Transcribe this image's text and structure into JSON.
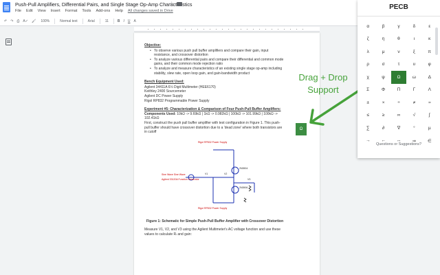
{
  "doc": {
    "title": "Push-Pull Amplifiers, Differential Pairs, and Single Stage Op-Amp Characteristics",
    "menu": [
      "File",
      "Edit",
      "View",
      "Insert",
      "Format",
      "Tools",
      "Add-ons",
      "Help"
    ],
    "saved_status": "All changes saved in Drive"
  },
  "toolbar": {
    "zoom": "100%",
    "style": "Normal text",
    "font": "Arial",
    "size": "11"
  },
  "content": {
    "objective_title": "Objective:",
    "objectives": [
      "To observe various push pull buffer amplifiers and compare their gain, input resistance, and crossover distortion",
      "To analyze various differential pairs and compare their differential and common mode gains, and their common mode rejection ratio",
      "To analyze and measure characteristics of an existing single stage op-amp including stability, slew rate, open loop gain, and gain-bandwidth product"
    ],
    "bench_title": "Bench Equipment Used:",
    "bench_items": [
      "Agilent 34411A 6½ Digit Multimeter (HEE6170)",
      "Keithley 2400 Sourcemeter",
      "Agilent DC Power Supply",
      "Rigol RP832 Programmable Power Supply"
    ],
    "experiment_title": "Experiment #5: Characterization & Comparison of Four Push-Pull Buffer Amplifiers:",
    "components_label": "Components Used:",
    "components_text": "10kΩ -> 9.69kΩ | 1kΩ -> 0.982kΩ | 100kΩ -> 101.99kΩ | 100kΩ -> 102.41kΩ",
    "first_paragraph": "First, construct the push pull buffer amplifier with test configuration in Figure 1. This push-pull buffer should have crossover distortion due to a 'dead zone' where both transistors are in cutoff",
    "figure_caption": "Figure 1: Schematic for Simple Push-Pull Buffer Amplifier with Crossover Distortion",
    "measure_paragraph": "Measure V1, V2, and V3 using the Agilent Multimeter's AC voltage function and use these values to calculate Rₗ and gain:"
  },
  "schematic": {
    "labels": [
      "Rigol RP832 Power Supply",
      "Sine Wave Sine Wave",
      "Agilent 33120A Function Generator",
      "Rigol RP832 Power Supply",
      "2N3904",
      "2N3906",
      "V1",
      "V2",
      "V3"
    ]
  },
  "overlay": {
    "drag_label_line1": "Drag + Drop",
    "drag_label_line2": "Support",
    "accent_color": "#46a23a"
  },
  "panel": {
    "title": "PECB",
    "symbols": [
      "α",
      "β",
      "γ",
      "δ",
      "ε",
      "ζ",
      "η",
      "θ",
      "ι",
      "κ",
      "λ",
      "μ",
      "ν",
      "ξ",
      "π",
      "ρ",
      "σ",
      "τ",
      "υ",
      "φ",
      "χ",
      "ψ",
      "Ω",
      "ω",
      "Δ",
      "Σ",
      "Φ",
      "Π",
      "Γ",
      "Λ",
      "±",
      "×",
      "÷",
      "≠",
      "≈",
      "≤",
      "≥",
      "∞",
      "√",
      "∫",
      "∑",
      "∂",
      "∇",
      "°",
      "µ",
      "→",
      "←",
      "↔",
      "⇒",
      "∈"
    ],
    "selected_index": 22,
    "suggestions_link": "Questions or Suggestions?"
  },
  "float_button_icon": "omega-icon"
}
